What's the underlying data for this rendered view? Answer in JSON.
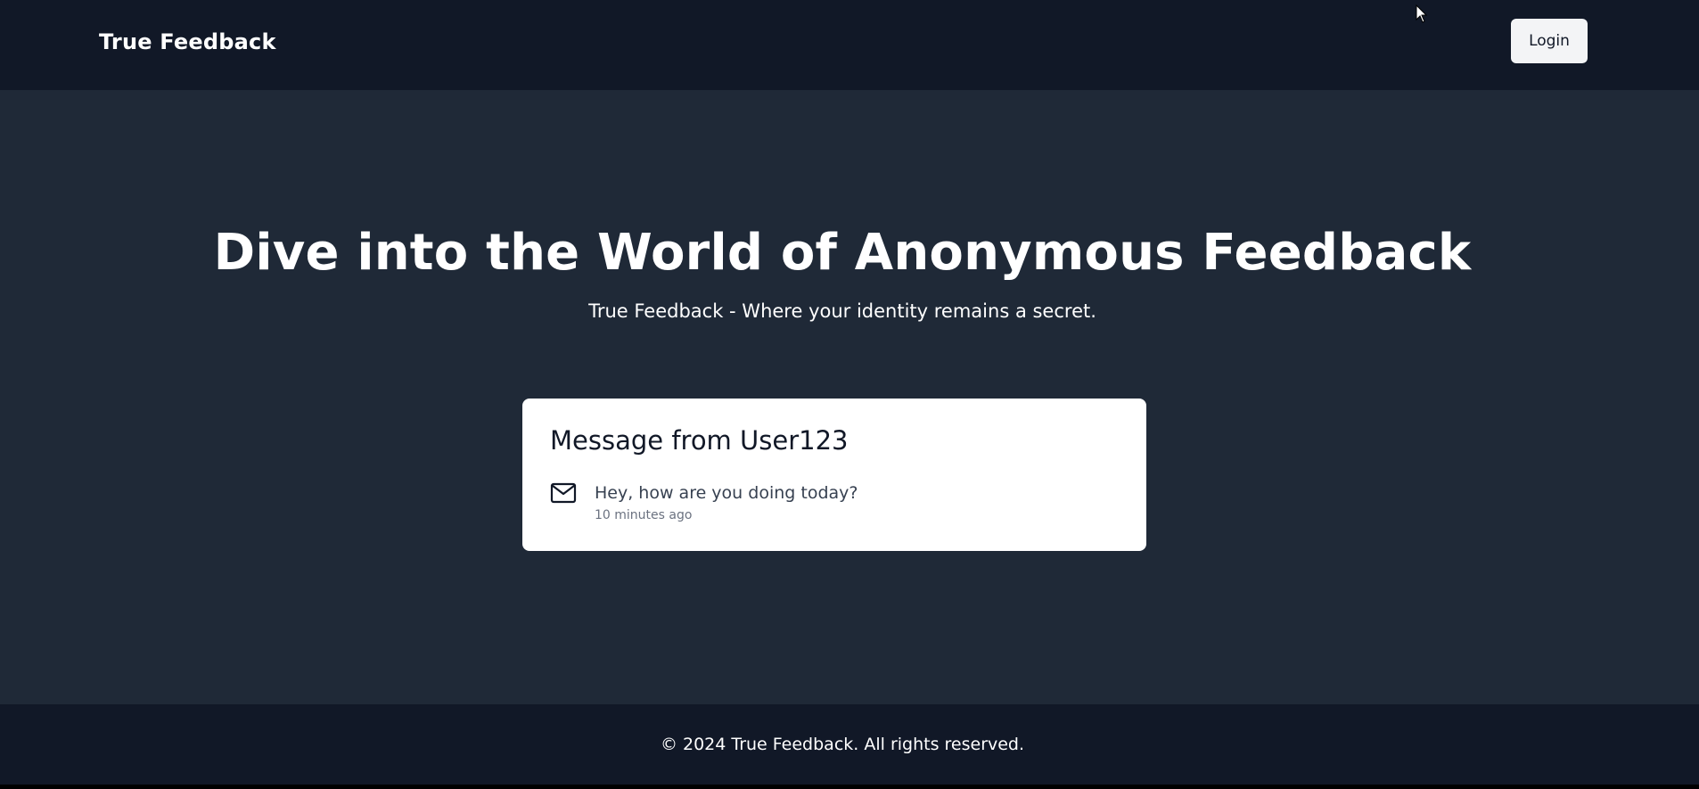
{
  "header": {
    "brand": "True Feedback",
    "login_label": "Login"
  },
  "hero": {
    "title": "Dive into the World of Anonymous Feedback",
    "subtitle": "True Feedback - Where your identity remains a secret."
  },
  "message_card": {
    "title": "Message from User123",
    "icon": "mail-icon",
    "text": "Hey, how are you doing today?",
    "time": "10 minutes ago"
  },
  "footer": {
    "text": "© 2024 True Feedback. All rights reserved."
  },
  "colors": {
    "header_bg": "#111827",
    "page_bg": "#1f2937",
    "card_bg": "#ffffff",
    "button_bg": "#f3f4f6"
  }
}
